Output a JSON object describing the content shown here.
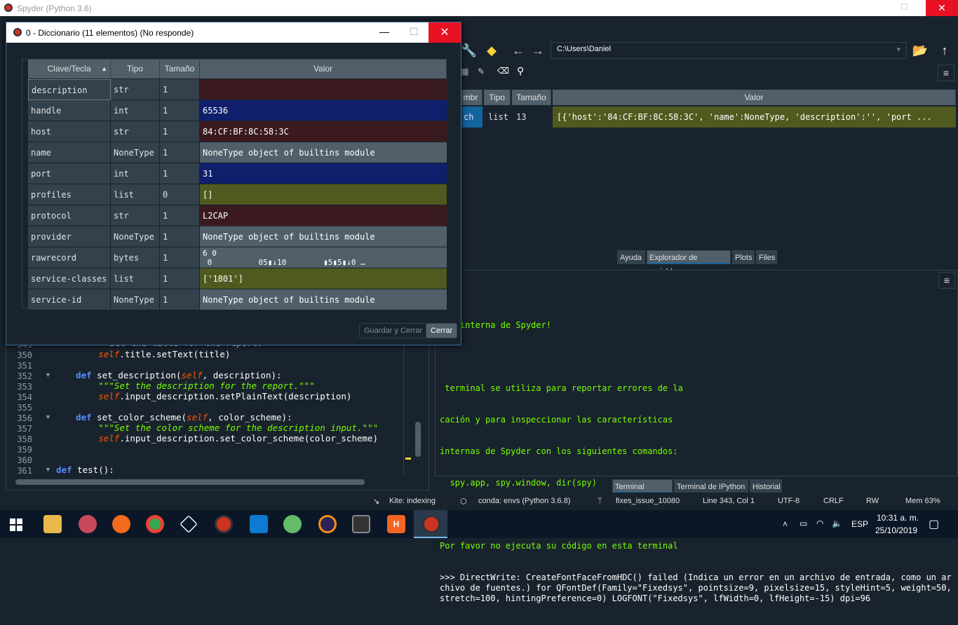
{
  "window": {
    "title": "Spyder (Python 3.6)"
  },
  "toolbar": {
    "path": "C:\\Users\\Daniel"
  },
  "variable_explorer": {
    "headers": [
      "mbr",
      "Tipo",
      "Tamaño",
      "Valor"
    ],
    "row": {
      "name": "ch",
      "type": "list",
      "size": "13",
      "value": "[{'host':'84:CF:BF:8C:58:3C', 'name':NoneType, 'description':'', 'port ..."
    },
    "tabs": [
      "Ayuda",
      "Explorador de variables",
      "Plots",
      "Files"
    ]
  },
  "console": {
    "lines": [
      "nal interna de Spyder!",
      "",
      " terminal se utiliza para reportar errores de la",
      "cación y para inspeccionar las características",
      "internas de Spyder con los siguientes comandos:",
      "  spy.app, spy.window, dir(spy)",
      "",
      "Por favor no ejecuta su código en esta terminal"
    ],
    "output": ">>> DirectWrite: CreateFontFaceFromHDC() failed (Indica un error en un archivo de entrada, como un archivo de fuentes.) for QFontDef(Family=\"Fixedsys\", pointsize=9, pixelsize=15, styleHint=5, weight=50, stretch=100, hintingPreference=0) LOGFONT(\"Fixedsys\", lfWidth=0, lfHeight=-15) dpi=96",
    "tabs": [
      "Terminal interna",
      "Terminal de IPython",
      "Historial"
    ]
  },
  "editor": {
    "line_numbers": [
      "349",
      "350",
      "351",
      "352",
      "353",
      "354",
      "355",
      "356",
      "357",
      "358",
      "359",
      "360",
      "361"
    ],
    "partial_line": "Set the title for the report.",
    "lines": [
      {
        "indent": "        ",
        "self": "self",
        "rest": ".title.setText(title)"
      },
      {
        "indent": "",
        "self": "",
        "rest": ""
      },
      {
        "def": "def ",
        "name": "set_description",
        "args_open": "(",
        "self": "self",
        "args": ", description):"
      },
      {
        "indent": "        ",
        "doc": "\"\"\"Set the description for the report.\"\"\""
      },
      {
        "indent": "        ",
        "self": "self",
        "rest": ".input_description.setPlainText(description)"
      },
      {
        "indent": "",
        "self": "",
        "rest": ""
      },
      {
        "def": "def ",
        "name": "set_color_scheme",
        "args_open": "(",
        "self": "self",
        "args": ", color_scheme):"
      },
      {
        "indent": "        ",
        "doc": "\"\"\"Set the color scheme for the description input.\"\"\""
      },
      {
        "indent": "        ",
        "self": "self",
        "rest": ".input_description.set_color_scheme(color_scheme)"
      },
      {
        "indent": "",
        "self": "",
        "rest": ""
      },
      {
        "indent": "",
        "self": "",
        "rest": ""
      },
      {
        "def": "def ",
        "name": "test",
        "args_open": "():",
        "self": "",
        "args": ""
      }
    ]
  },
  "status": {
    "kite": "Kite: indexing",
    "conda": "conda: envs (Python 3.6.8)",
    "branch": "fixes_issue_10080",
    "position": "Line 343, Col 1",
    "encoding": "UTF-8",
    "eol": "CRLF",
    "rw": "RW",
    "mem": "Mem 63%"
  },
  "taskbar": {
    "lang": "ESP",
    "time": "10:31 a. m.",
    "date": "25/10/2019"
  },
  "dialog": {
    "title": "0 - Diccionario (11 elementos) (No responde)",
    "headers": [
      "Clave/Tecla",
      "Tipo",
      "Tamaño",
      "Valor"
    ],
    "rows": [
      {
        "key": "description",
        "type": "str",
        "size": "1",
        "value": "",
        "color": "#3b1a1f"
      },
      {
        "key": "handle",
        "type": "int",
        "size": "1",
        "value": "65536",
        "color": "#0f1f6b"
      },
      {
        "key": "host",
        "type": "str",
        "size": "1",
        "value": "84:CF:BF:8C:58:3C",
        "color": "#3b1a1f"
      },
      {
        "key": "name",
        "type": "NoneType",
        "size": "1",
        "value": "NoneType object of builtins module",
        "color": "#505f69"
      },
      {
        "key": "port",
        "type": "int",
        "size": "1",
        "value": "31",
        "color": "#0f1f6b"
      },
      {
        "key": "profiles",
        "type": "list",
        "size": "0",
        "value": "[]",
        "color": "#505a1e"
      },
      {
        "key": "protocol",
        "type": "str",
        "size": "1",
        "value": "L2CAP",
        "color": "#3b1a1f"
      },
      {
        "key": "provider",
        "type": "NoneType",
        "size": "1",
        "value": "NoneType object of builtins module",
        "color": "#505f69"
      },
      {
        "key": "rawrecord",
        "type": "bytes",
        "size": "1",
        "value": "6 0\n 0          05▮↓10        ▮5▮5▮↓0 …",
        "color": "#505f69"
      },
      {
        "key": "service-classes",
        "type": "list",
        "size": "1",
        "value": "['1801']",
        "color": "#505a1e"
      },
      {
        "key": "service-id",
        "type": "NoneType",
        "size": "1",
        "value": "NoneType object of builtins module",
        "color": "#505f69"
      }
    ],
    "save_label": "Guardar y Cerrar",
    "close_label": "Cerrar"
  }
}
